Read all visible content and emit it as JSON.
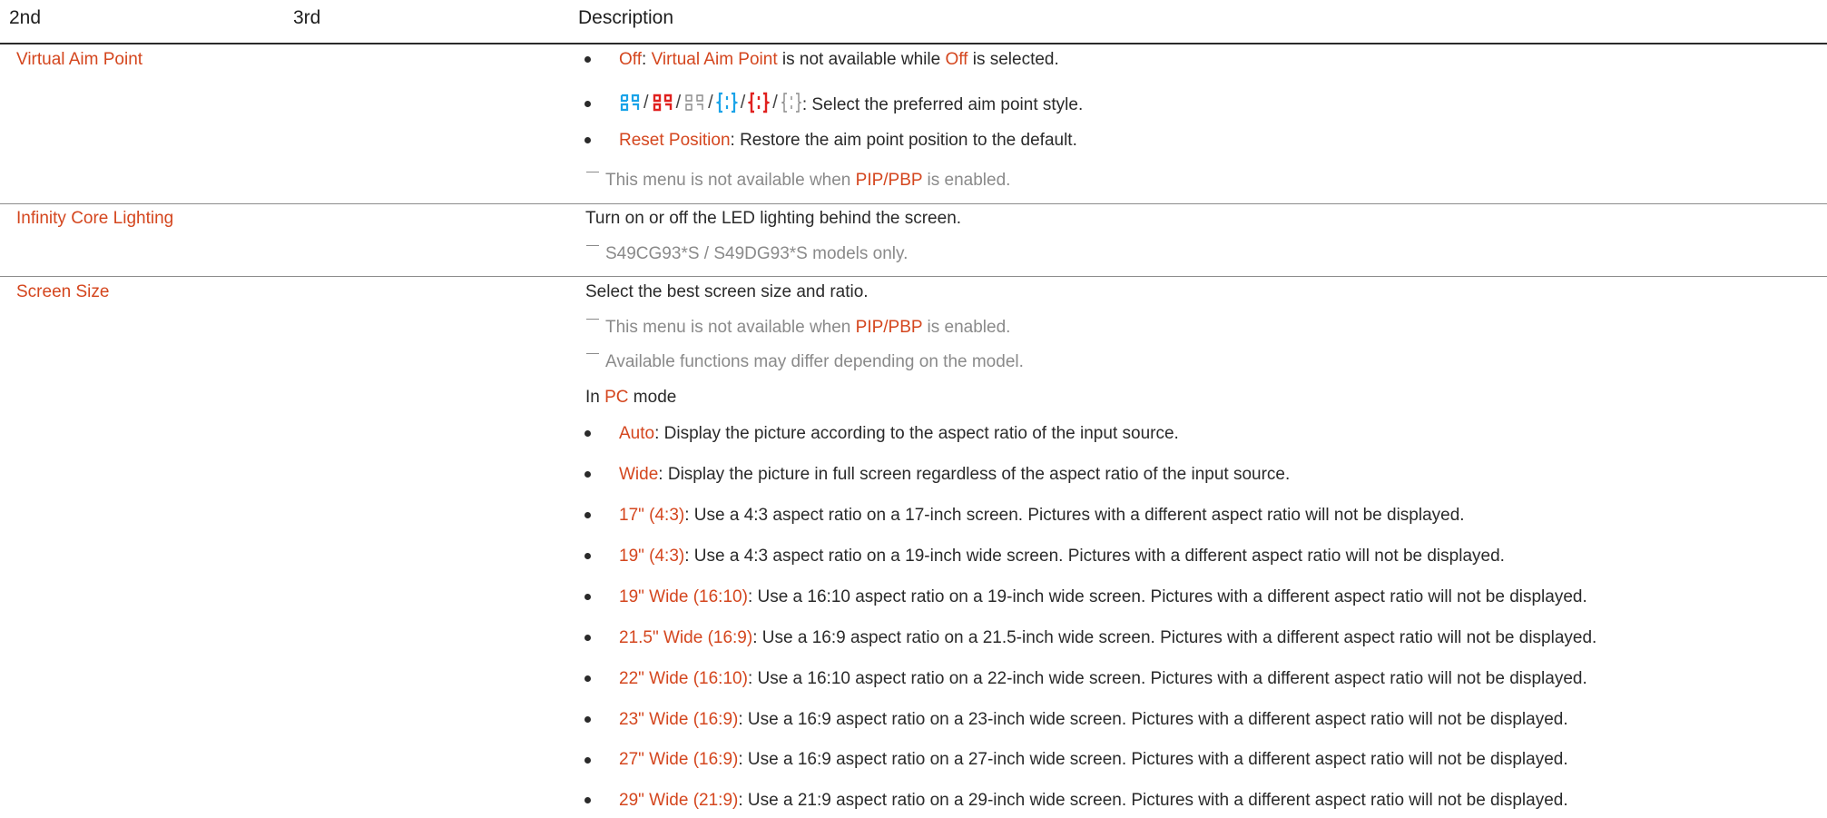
{
  "header": {
    "col1": "2nd",
    "col2": "3rd",
    "col3": "Description"
  },
  "rows": {
    "aim": {
      "label": "Virtual Aim Point",
      "b1_key": "Off",
      "b1_sep1": ": ",
      "b1_mid_key": "Virtual Aim Point",
      "b1_mid": " is not available while ",
      "b1_end_key": "Off",
      "b1_end": " is selected.",
      "b2_text": ": Select the preferred aim point style.",
      "b2_sep": "/",
      "b3_key": "Reset Position",
      "b3_text": ": Restore the aim point position to the default.",
      "note_pre": "This menu is not available when ",
      "note_key": "PIP/PBP",
      "note_post": " is enabled."
    },
    "lighting": {
      "label": "Infinity Core Lighting",
      "text": "Turn on or off the LED lighting behind the screen.",
      "note": "S49CG93*S / S49DG93*S models only."
    },
    "screen": {
      "label": "Screen Size",
      "text": "Select the best screen size and ratio.",
      "note1_pre": "This menu is not available when ",
      "note1_key": "PIP/PBP",
      "note1_post": " is enabled.",
      "note2": "Available functions may differ depending on the model.",
      "mode_pre": "In ",
      "mode_key": "PC",
      "mode_post": " mode",
      "items": [
        {
          "key": "Auto",
          "text": ": Display the picture according to the aspect ratio of the input source."
        },
        {
          "key": "Wide",
          "text": ": Display the picture in full screen regardless of the aspect ratio of the input source."
        },
        {
          "key": "17\" (4:3)",
          "text": ": Use a 4:3 aspect ratio on a 17-inch screen. Pictures with a different aspect ratio will not be displayed."
        },
        {
          "key": "19\" (4:3)",
          "text": ": Use a 4:3 aspect ratio on a 19-inch wide screen. Pictures with a different aspect ratio will not be displayed."
        },
        {
          "key": "19\" Wide (16:10)",
          "text": ": Use a 16:10 aspect ratio on a 19-inch wide screen. Pictures with a different aspect ratio will not be displayed."
        },
        {
          "key": "21.5\" Wide (16:9)",
          "text": ": Use a 16:9 aspect ratio on a 21.5-inch wide screen. Pictures with a different aspect ratio will not be displayed."
        },
        {
          "key": "22\" Wide (16:10)",
          "text": ": Use a 16:10 aspect ratio on a 22-inch wide screen. Pictures with a different aspect ratio will not be displayed."
        },
        {
          "key": "23\" Wide (16:9)",
          "text": ": Use a 16:9 aspect ratio on a 23-inch wide screen. Pictures with a different aspect ratio will not be displayed."
        },
        {
          "key": "27\" Wide (16:9)",
          "text": ": Use a 16:9 aspect ratio on a 27-inch wide screen. Pictures with a different aspect ratio will not be displayed."
        },
        {
          "key": "29\" Wide (21:9)",
          "text": ": Use a 21:9 aspect ratio on a 29-inch wide screen. Pictures with a different aspect ratio will not be displayed."
        }
      ]
    }
  },
  "colors": {
    "highlight": "#d4461e",
    "note": "#8a8a8a",
    "aim_blue": "#1aa3e8",
    "aim_red": "#e0201e",
    "aim_gray": "#8a8a8a"
  },
  "icons": [
    "aim-style-cross-blue-icon",
    "aim-style-cross-red-icon",
    "aim-style-cross-gray-icon",
    "aim-style-bracket-blue-icon",
    "aim-style-bracket-red-icon",
    "aim-style-bracket-gray-icon"
  ]
}
